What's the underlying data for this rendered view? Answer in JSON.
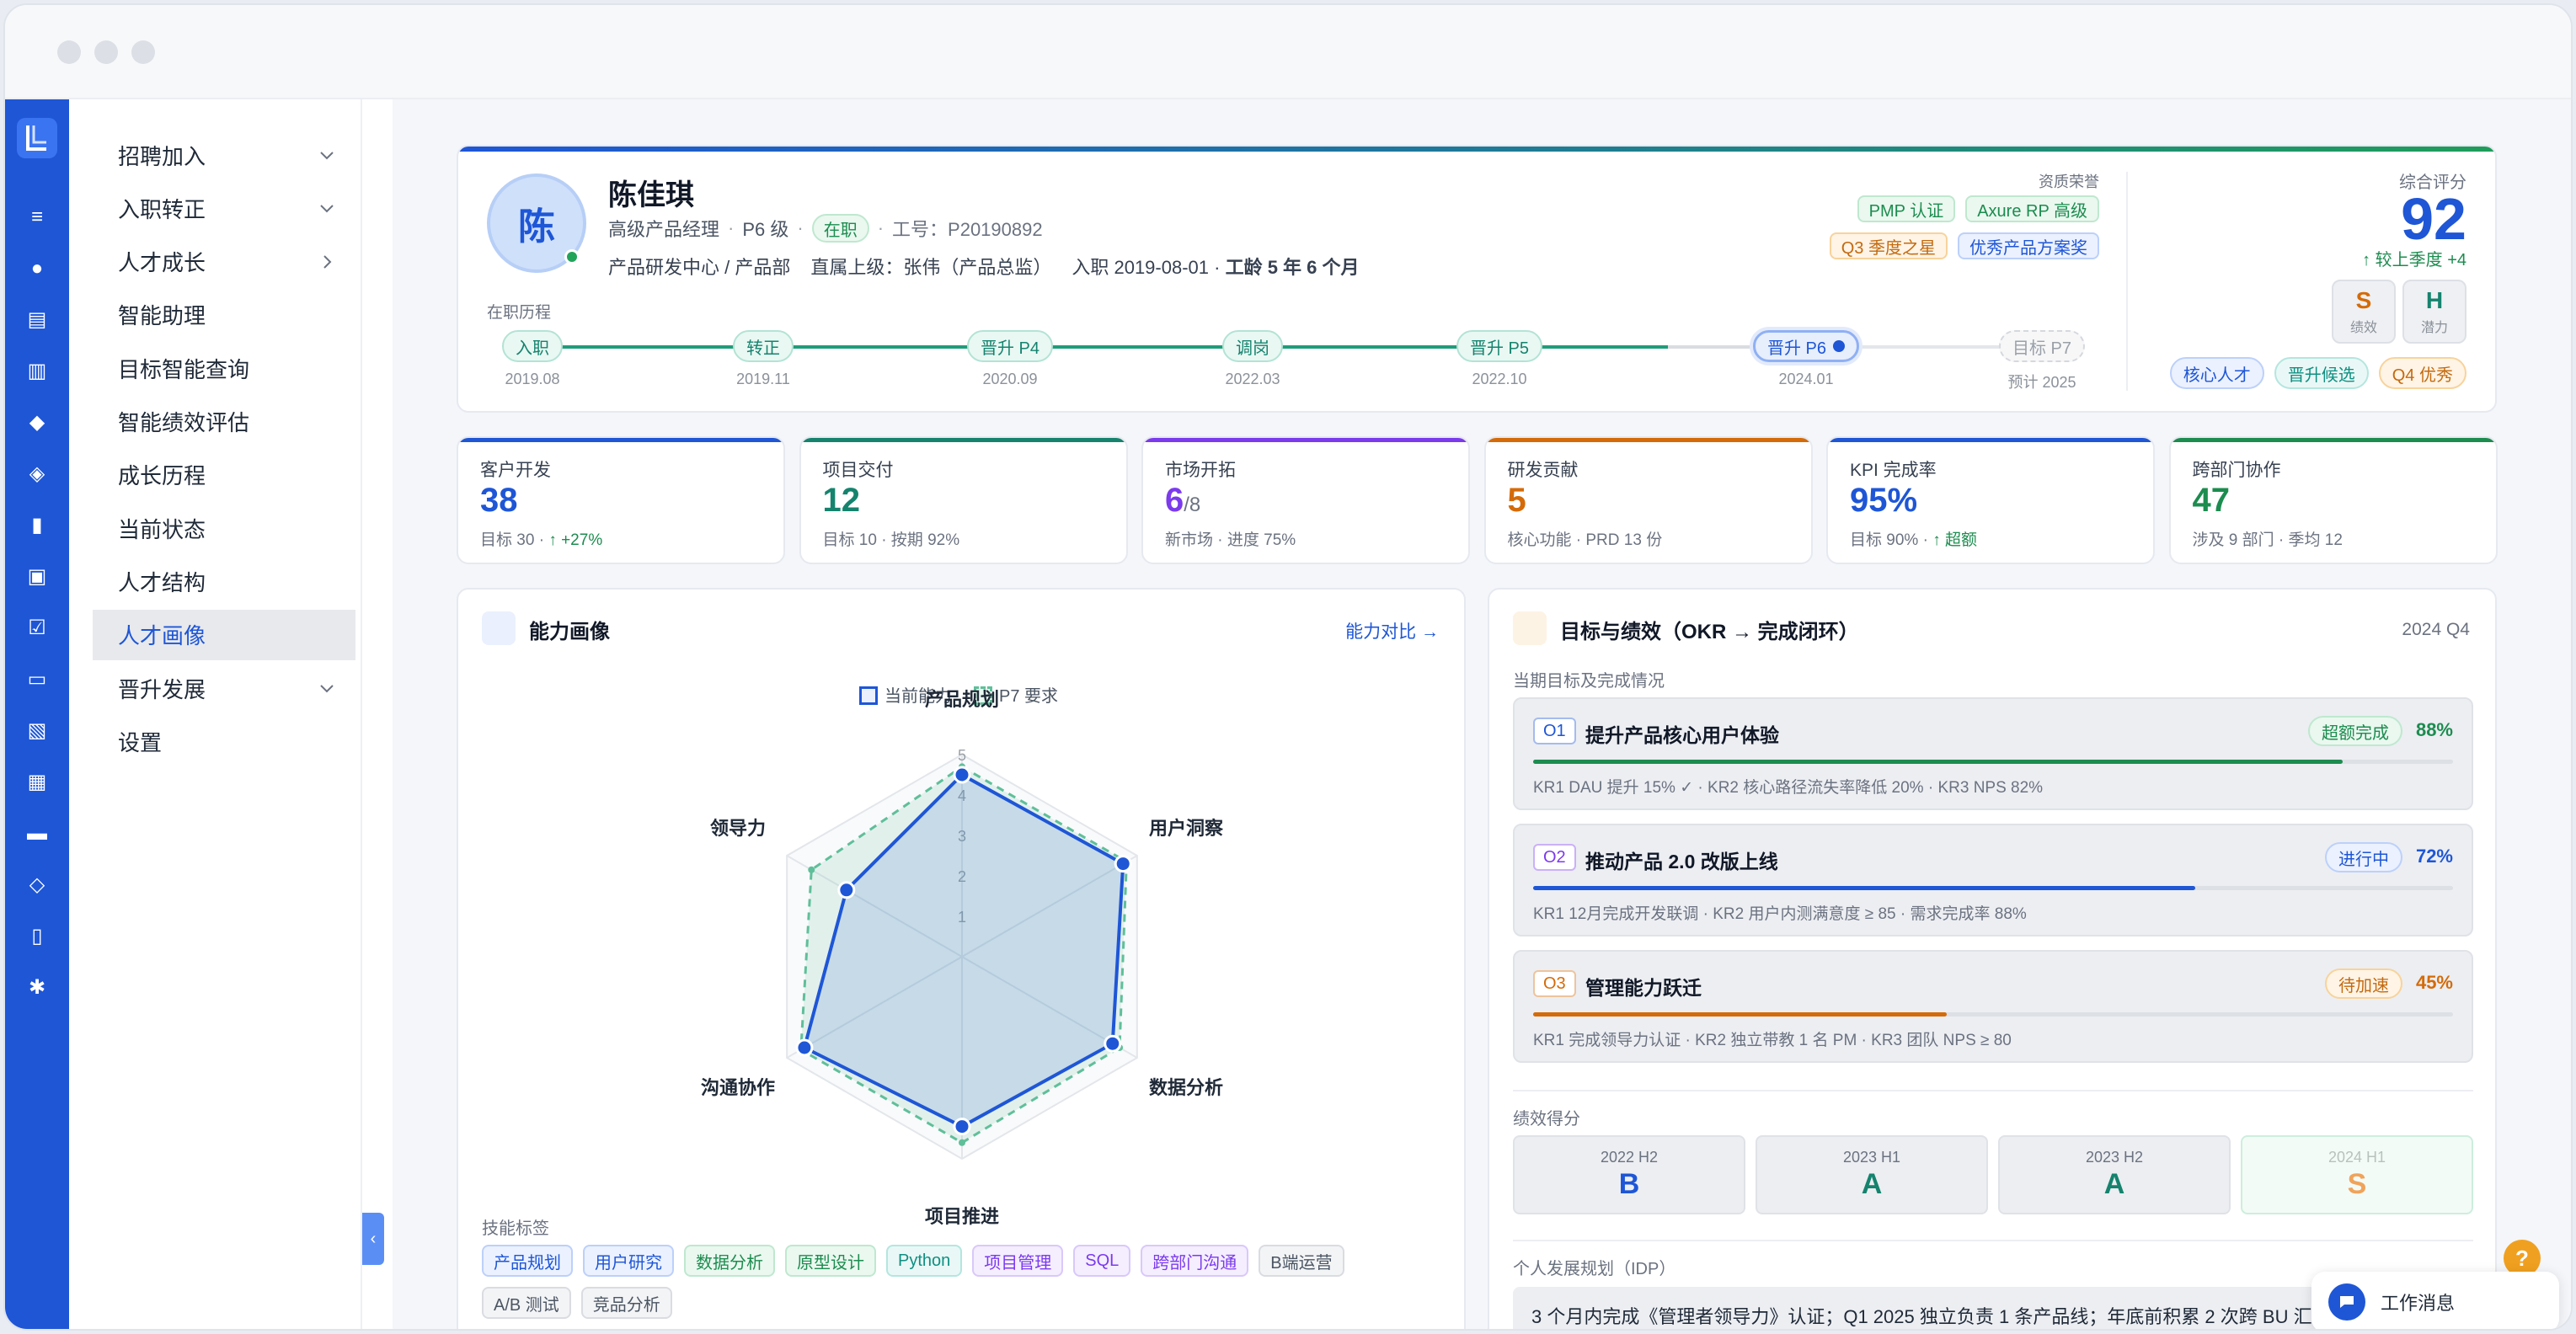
{
  "sidebar": {
    "items": [
      {
        "label": "招聘加入",
        "chevron": "down"
      },
      {
        "label": "入职转正",
        "chevron": "down"
      },
      {
        "label": "人才成长",
        "chevron": "right"
      },
      {
        "label": "智能助理"
      },
      {
        "label": "目标智能查询"
      },
      {
        "label": "智能绩效评估"
      },
      {
        "label": "成长历程"
      },
      {
        "label": "当前状态"
      },
      {
        "label": "人才结构"
      },
      {
        "label": "人才画像",
        "active": true
      },
      {
        "label": "晋升发展",
        "chevron": "down"
      },
      {
        "label": "设置"
      }
    ],
    "rail_icons": [
      "list-icon",
      "user-icon",
      "id-card-icon",
      "org-chart-icon",
      "cube-icon",
      "shield-check-icon",
      "briefcase-icon",
      "settings-window-icon",
      "checklist-icon",
      "book-icon",
      "pdf-icon",
      "calendar-check-icon",
      "credit-card-icon",
      "layers-icon",
      "bar-chart-icon",
      "gear-icon"
    ]
  },
  "profile": {
    "avatar_char": "陈",
    "name": "陈佳琪",
    "title": "高级产品经理",
    "level": "P6 级",
    "status": "在职",
    "employee_id": "工号：P20190892",
    "department": "产品研发中心 / 产品部",
    "manager": "直属上级：张伟（产品总监）",
    "join_date": "入职 2019-08-01 ·",
    "tenure": "工龄 5 年 6 个月",
    "history_label": "在职历程",
    "timeline": [
      {
        "label": "入职",
        "date": "2019.08",
        "state": "done"
      },
      {
        "label": "转正",
        "date": "2019.11",
        "state": "done"
      },
      {
        "label": "晋升 P4",
        "date": "2020.09",
        "state": "done"
      },
      {
        "label": "调岗",
        "date": "2022.03",
        "state": "done"
      },
      {
        "label": "晋升 P5",
        "date": "2022.10",
        "state": "done"
      },
      {
        "label": "晋升 P6",
        "date": "2024.01",
        "state": "current"
      },
      {
        "label": "目标 P7",
        "date": "预计 2025",
        "state": "future"
      }
    ],
    "honors_title": "资质荣誉",
    "honors": [
      {
        "label": "PMP 认证",
        "color": "green"
      },
      {
        "label": "Axure RP 高级",
        "color": "green"
      },
      {
        "label": "Q3 季度之星",
        "color": "orange"
      },
      {
        "label": "优秀产品方案奖",
        "color": "blue"
      }
    ],
    "score_title": "综合评分",
    "score": "92",
    "score_delta": "↑ 较上季度 +4",
    "s_letter": "S",
    "s_label": "绩效",
    "h_letter": "H",
    "h_label": "潜力",
    "score_tags": [
      {
        "label": "核心人才",
        "color": "blue"
      },
      {
        "label": "晋升候选",
        "color": "teal"
      },
      {
        "label": "Q4 优秀",
        "color": "orange"
      }
    ]
  },
  "kpis": [
    {
      "title": "客户开发",
      "value": "38",
      "suffix": "",
      "sub": "目标 30 · ",
      "sub_green": "↑ +27%",
      "color": "#1e56d6"
    },
    {
      "title": "项目交付",
      "value": "12",
      "suffix": "",
      "sub": "目标 10 · 按期 92%",
      "sub_green": "",
      "color": "#15836e"
    },
    {
      "title": "市场开拓",
      "value": "6",
      "suffix": "/8",
      "sub": "新市场 · 进度 75%",
      "sub_green": "",
      "color": "#7c3aed"
    },
    {
      "title": "研发贡献",
      "value": "5",
      "suffix": "",
      "sub": "核心功能 · PRD 13 份",
      "sub_green": "",
      "color": "#d46b08"
    },
    {
      "title": "KPI 完成率",
      "value": "95%",
      "suffix": "",
      "sub": "目标 90% · ",
      "sub_green": "↑ 超额",
      "color": "#1e56d6"
    },
    {
      "title": "跨部门协作",
      "value": "47",
      "suffix": "",
      "sub": "涉及 9 部门 · 季均 12",
      "sub_green": "",
      "color": "#1c8c4f"
    }
  ],
  "ability": {
    "title": "能力画像",
    "compare_link": "能力对比 →",
    "legend_current": "当前能力",
    "legend_required": "P7 要求",
    "skills_title": "技能标签",
    "skills": [
      {
        "label": "产品规划",
        "color": "blue"
      },
      {
        "label": "用户研究",
        "color": "blue"
      },
      {
        "label": "数据分析",
        "color": "green"
      },
      {
        "label": "原型设计",
        "color": "green"
      },
      {
        "label": "Python",
        "color": "teal"
      },
      {
        "label": "项目管理",
        "color": "purple"
      },
      {
        "label": "SQL",
        "color": "purple"
      },
      {
        "label": "跨部门沟通",
        "color": "purple"
      },
      {
        "label": "B端运营",
        "color": "gray"
      },
      {
        "label": "A/B 测试",
        "color": "gray"
      },
      {
        "label": "竞品分析",
        "color": "gray"
      }
    ]
  },
  "chart_data": {
    "type": "radar",
    "axes": [
      "产品规划",
      "用户洞察",
      "数据分析",
      "项目推进",
      "沟通协作",
      "领导力"
    ],
    "rlim": [
      0,
      5
    ],
    "ticks": [
      "1",
      "2",
      "3",
      "4",
      "5"
    ],
    "series": [
      {
        "name": "当前能力",
        "values": [
          4.5,
          4.6,
          4.3,
          4.2,
          4.5,
          3.3
        ],
        "color": "#1e56d6"
      },
      {
        "name": "P7 要求",
        "values": [
          4.7,
          4.7,
          4.5,
          4.6,
          4.6,
          4.3
        ],
        "color": "#5fbf9a"
      }
    ]
  },
  "okr": {
    "title": "目标与绩效（OKR → 完成闭环）",
    "period": "2024 Q4",
    "sub": "当期目标及完成情况",
    "items": [
      {
        "id": "O1",
        "title": "提升产品核心用户体验",
        "status": "超额完成",
        "pct": "88%",
        "progress": 0.88,
        "krs": "KR1 DAU 提升 15% ✓ · KR2 核心路径流失率降低 20% · KR3 NPS 82%",
        "color": "#1c8c4f",
        "tone": "green"
      },
      {
        "id": "O2",
        "title": "推动产品 2.0 改版上线",
        "status": "进行中",
        "pct": "72%",
        "progress": 0.72,
        "krs": "KR1 12月完成开发联调 · KR2 用户内测满意度 ≥ 85 · 需求完成率 88%",
        "color": "#1e56d6",
        "tone": "blue"
      },
      {
        "id": "O3",
        "title": "管理能力跃迁",
        "status": "待加速",
        "pct": "45%",
        "progress": 0.45,
        "krs": "KR1 完成领导力认证 · KR2 独立带教 1 名 PM · KR3 团队 NPS ≥ 80",
        "color": "#d46b08",
        "tone": "orange"
      }
    ],
    "perf_title": "绩效得分",
    "perf": [
      {
        "period": "2022 H2",
        "grade": "B",
        "color": "#1e56d6"
      },
      {
        "period": "2023 H1",
        "grade": "A",
        "color": "#15836e"
      },
      {
        "period": "2023 H2",
        "grade": "A",
        "color": "#15836e"
      },
      {
        "period": "2024 H1",
        "grade": "S",
        "color": "#f0a35a"
      }
    ],
    "idp_title": "个人发展规划（IDP）",
    "idp_text": "3 个月内完成《管理者领导力》认证；Q1 2025 独立负责 1 条产品线；年底前积累 2 次跨 BU 汇报"
  },
  "widgets": {
    "help": "?",
    "message": "工作消息"
  }
}
